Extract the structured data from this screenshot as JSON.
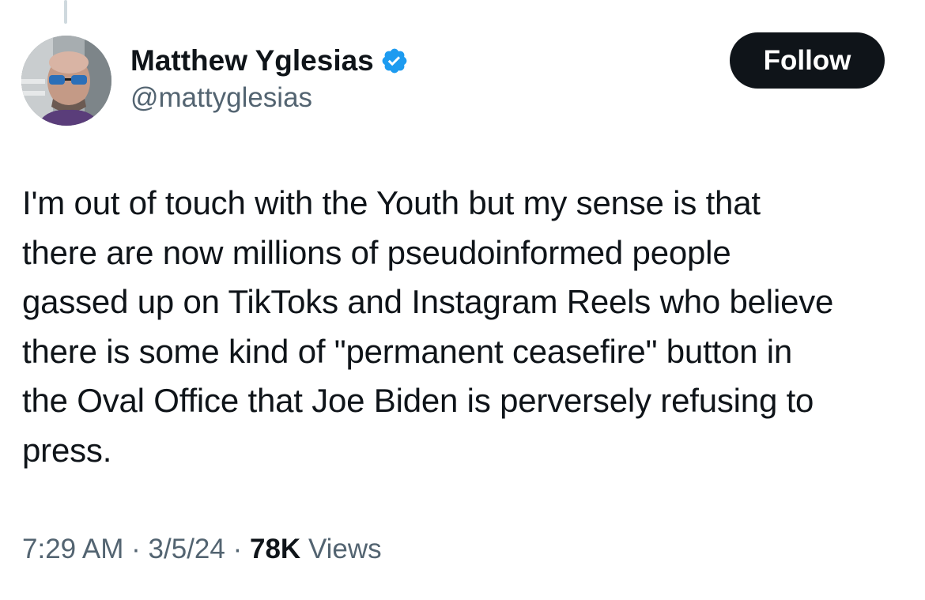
{
  "author": {
    "display_name": "Matthew Yglesias",
    "handle": "@mattyglesias",
    "verified": true,
    "verified_color": "#1d9bf0"
  },
  "follow_button": {
    "label": "Follow"
  },
  "tweet": {
    "text_lines": [
      "I'm out of touch with the Youth but my sense is that",
      "there are now millions of pseudoinformed people",
      "gassed up on TikToks and Instagram Reels who believe",
      "there is some kind of \"permanent ceasefire\" button in",
      "the Oval Office that Joe Biden is perversely refusing to",
      "press."
    ]
  },
  "meta": {
    "time": "7:29 AM",
    "separator": "·",
    "date": "3/5/24",
    "views_count": "78K",
    "views_label": "Views"
  },
  "icons": {
    "verified": "verified-badge-icon",
    "avatar": "user-avatar"
  },
  "colors": {
    "text": "#0f1419",
    "secondary_text": "#536471",
    "button_bg": "#0f1419",
    "button_text": "#ffffff",
    "thread_line": "#cfd9de"
  }
}
